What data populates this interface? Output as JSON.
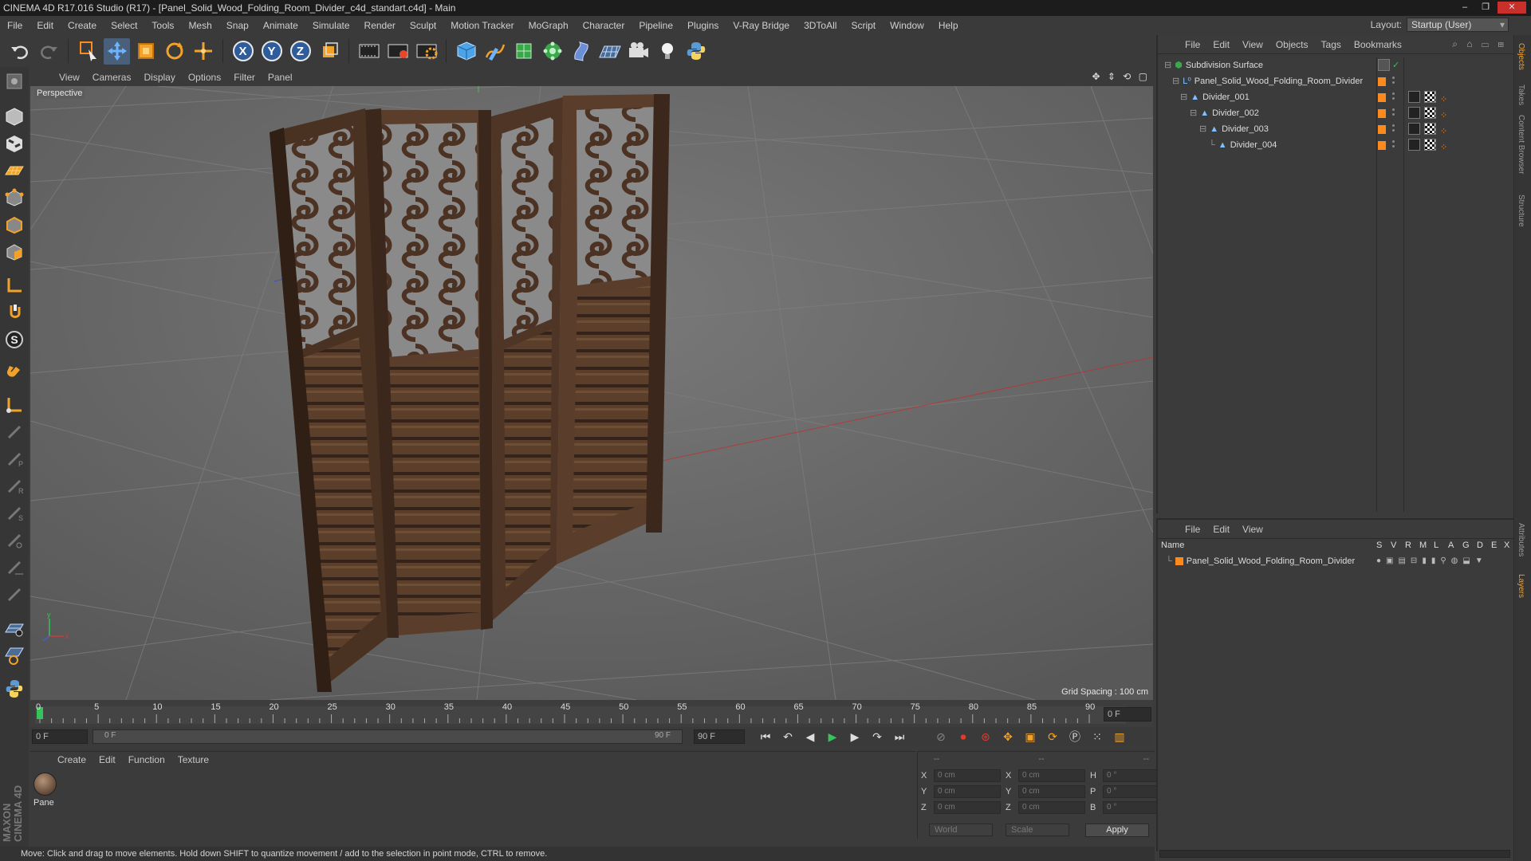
{
  "window": {
    "title": "CINEMA 4D R17.016 Studio (R17) - [Panel_Solid_Wood_Folding_Room_Divider_c4d_standart.c4d] - Main"
  },
  "menu": [
    "File",
    "Edit",
    "Create",
    "Select",
    "Tools",
    "Mesh",
    "Snap",
    "Animate",
    "Simulate",
    "Render",
    "Sculpt",
    "Motion Tracker",
    "MoGraph",
    "Character",
    "Pipeline",
    "Plugins",
    "V-Ray Bridge",
    "3DToAll",
    "Script",
    "Window",
    "Help"
  ],
  "layout": {
    "label": "Layout:",
    "value": "Startup (User)"
  },
  "toolbar": {
    "axes": [
      "X",
      "Y",
      "Z"
    ],
    "icons": [
      "undo-icon",
      "redo-icon",
      "live-select-icon",
      "move-icon",
      "scale-icon",
      "rotate-icon",
      "transform-icon",
      "x-axis-lock",
      "y-axis-lock",
      "z-axis-lock",
      "coordinate-system-icon",
      "render-view-icon",
      "render-picture-viewer-icon",
      "render-settings-icon",
      "cube-icon",
      "pen-spline-icon",
      "subdivision-icon",
      "array-icon",
      "deformer-icon",
      "floor-icon",
      "camera-icon",
      "light-icon",
      "python-icon"
    ]
  },
  "viewport": {
    "menu": [
      "View",
      "Cameras",
      "Display",
      "Options",
      "Filter",
      "Panel"
    ],
    "label": "Perspective",
    "grid_spacing": "Grid Spacing : 100 cm"
  },
  "timeline": {
    "ticks": [
      "0",
      "5",
      "10",
      "15",
      "20",
      "25",
      "30",
      "35",
      "40",
      "45",
      "50",
      "55",
      "60",
      "65",
      "70",
      "75",
      "80",
      "85",
      "90"
    ],
    "current_frame": "0 F",
    "start_field": "0 F",
    "range_start": "0 F",
    "range_end": "90 F",
    "end_field": "90 F"
  },
  "material_manager": {
    "menu": [
      "Create",
      "Edit",
      "Function",
      "Texture"
    ],
    "materials": [
      {
        "name": "Pane"
      }
    ]
  },
  "coordinates": {
    "headers": [
      "--",
      "--",
      "--"
    ],
    "rows": [
      {
        "a": "X",
        "av": "0 cm",
        "b": "X",
        "bv": "0 cm",
        "c": "H",
        "cv": "0 °"
      },
      {
        "a": "Y",
        "av": "0 cm",
        "b": "Y",
        "bv": "0 cm",
        "c": "P",
        "cv": "0 °"
      },
      {
        "a": "Z",
        "av": "0 cm",
        "b": "Z",
        "bv": "0 cm",
        "c": "B",
        "cv": "0 °"
      }
    ],
    "mode": "World",
    "transform": "Scale",
    "apply": "Apply"
  },
  "status": "Move: Click and drag to move elements. Hold down SHIFT to quantize movement / add to the selection in point mode, CTRL to remove.",
  "brand": "MAXON CINEMA 4D",
  "object_manager": {
    "menu": [
      "File",
      "Edit",
      "View",
      "Objects",
      "Tags",
      "Bookmarks"
    ],
    "objects": [
      {
        "name": "Subdivision Surface",
        "level": 0
      },
      {
        "name": "Panel_Solid_Wood_Folding_Room_Divider",
        "level": 1
      },
      {
        "name": "Divider_001",
        "level": 2
      },
      {
        "name": "Divider_002",
        "level": 3
      },
      {
        "name": "Divider_003",
        "level": 4
      },
      {
        "name": "Divider_004",
        "level": 5
      }
    ]
  },
  "layer_manager": {
    "menu": [
      "File",
      "Edit",
      "View"
    ],
    "columns": [
      "Name",
      "S",
      "V",
      "R",
      "M",
      "L",
      "A",
      "G",
      "D",
      "E",
      "X"
    ],
    "layers": [
      {
        "name": "Panel_Solid_Wood_Folding_Room_Divider"
      }
    ]
  },
  "right_tabs": [
    "Objects",
    "Takes",
    "Content Browser",
    "Structure",
    "Attributes",
    "Layers"
  ],
  "colors": {
    "accent_orange": "#ff8a1c",
    "viewport_bg": "#6b6b6b",
    "wood_dark": "#3e2a1c",
    "wood_light": "#7a5a40"
  }
}
